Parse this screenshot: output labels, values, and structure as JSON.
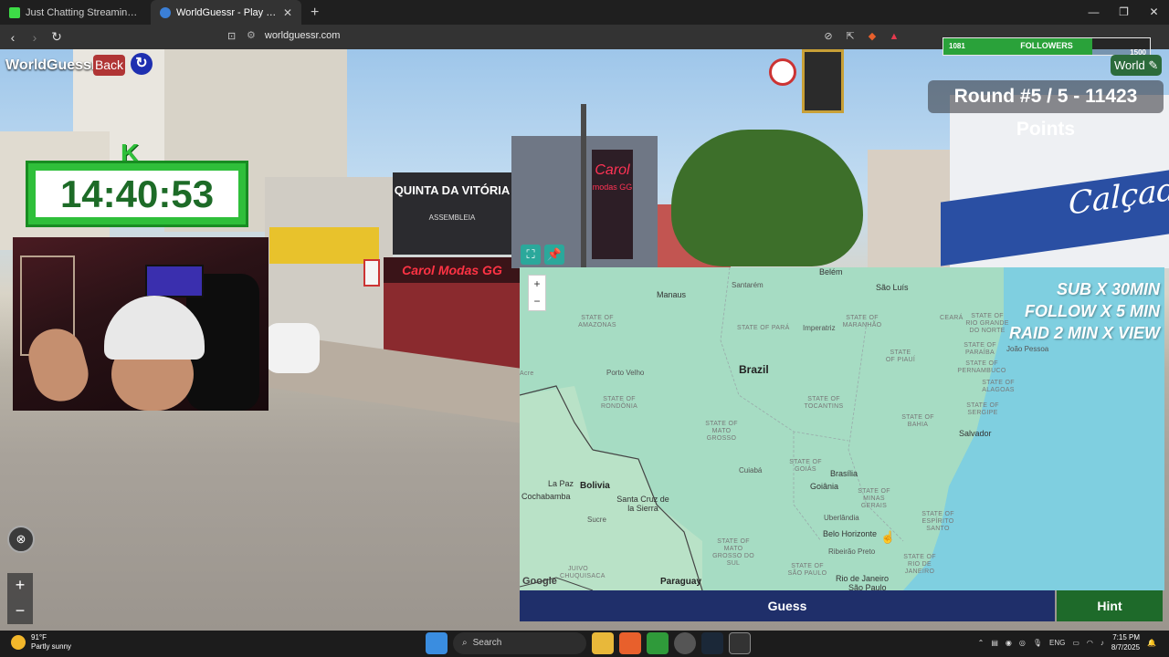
{
  "browser": {
    "tabs": [
      {
        "title": "Just Chatting Streaming - Live Stream",
        "active": false
      },
      {
        "title": "WorldGuessr - Play Geoguessr free",
        "active": true
      }
    ],
    "url": "worldguessr.com"
  },
  "game": {
    "logo": "WorldGuessr",
    "back_label": "Back",
    "mode_label": "World",
    "round_text": "Round #5 / 5 - 11423 Points",
    "guess_label": "Guess",
    "hint_label": "Hint"
  },
  "stream": {
    "followers_label": "FOLLOWERS",
    "followers_current": "1081",
    "followers_goal": "1500",
    "followers_progress": 0.72,
    "timer": "14:40:53",
    "timer_badge": "K",
    "subathon_lines": [
      "SUB X 30MIN",
      "FOLLOW X 5 MIN",
      "RAID 2 MIN X VIEW"
    ]
  },
  "street_signs": {
    "sign1": "QUINTA DA VITÓRIA",
    "sign1_sub": "ASSEMBLEIA",
    "sign2": "Carol Modas GG",
    "sign3": "Carol",
    "sign3_sub": "modas GG",
    "sign4": "Calçado"
  },
  "map": {
    "country": "Brazil",
    "cities": [
      {
        "name": "Manaus"
      },
      {
        "name": "Santarém"
      },
      {
        "name": "Belém"
      },
      {
        "name": "São Luís"
      },
      {
        "name": "Imperatriz"
      },
      {
        "name": "João Pessoa"
      },
      {
        "name": "Porto Velho"
      },
      {
        "name": "Salvador"
      },
      {
        "name": "Cuiabá"
      },
      {
        "name": "Brasília"
      },
      {
        "name": "Goiânia"
      },
      {
        "name": "Uberlândia"
      },
      {
        "name": "Belo Horizonte"
      },
      {
        "name": "Ribeirão Preto"
      },
      {
        "name": "Rio de Janeiro"
      },
      {
        "name": "São Paulo"
      },
      {
        "name": "La Paz"
      },
      {
        "name": "Cochabamba"
      },
      {
        "name": "Bolivia"
      },
      {
        "name": "Santa Cruz de la Sierra"
      },
      {
        "name": "Sucre"
      },
      {
        "name": "Paraguay"
      },
      {
        "name": "Acre"
      }
    ],
    "states": [
      "STATE OF AMAZONAS",
      "STATE OF PARÁ",
      "STATE OF MARANHÃO",
      "CEARÁ",
      "STATE OF RIO GRANDE DO NORTE",
      "STATE OF PIAUÍ",
      "STATE OF PARAÍBA",
      "STATE OF PERNAMBUCO",
      "STATE OF ALAGOAS",
      "STATE OF RONDÔNIA",
      "STATE OF TOCANTINS",
      "STATE OF BAHIA",
      "STATE OF SERGIPE",
      "STATE OF MATO GROSSO",
      "STATE OF GOIÁS",
      "STATE OF MINAS GERAIS",
      "STATE OF ESPÍRITO SANTO",
      "STATE OF MATO GROSSO DO SUL",
      "STATE OF SÃO PAULO",
      "STATE OF RIO DE JANEIRO",
      "JUIVO CHUQUISACA"
    ],
    "attribution": "Google"
  },
  "taskbar": {
    "temperature": "91°F",
    "weather": "Partly sunny",
    "search_placeholder": "Search",
    "language": "ENG",
    "time": "7:15 PM",
    "date": "8/7/2025"
  },
  "colors": {
    "guess": "#1f2f6a",
    "hint": "#1e6a2a",
    "back": "#b03535",
    "timer_green": "#2fbf3a"
  }
}
